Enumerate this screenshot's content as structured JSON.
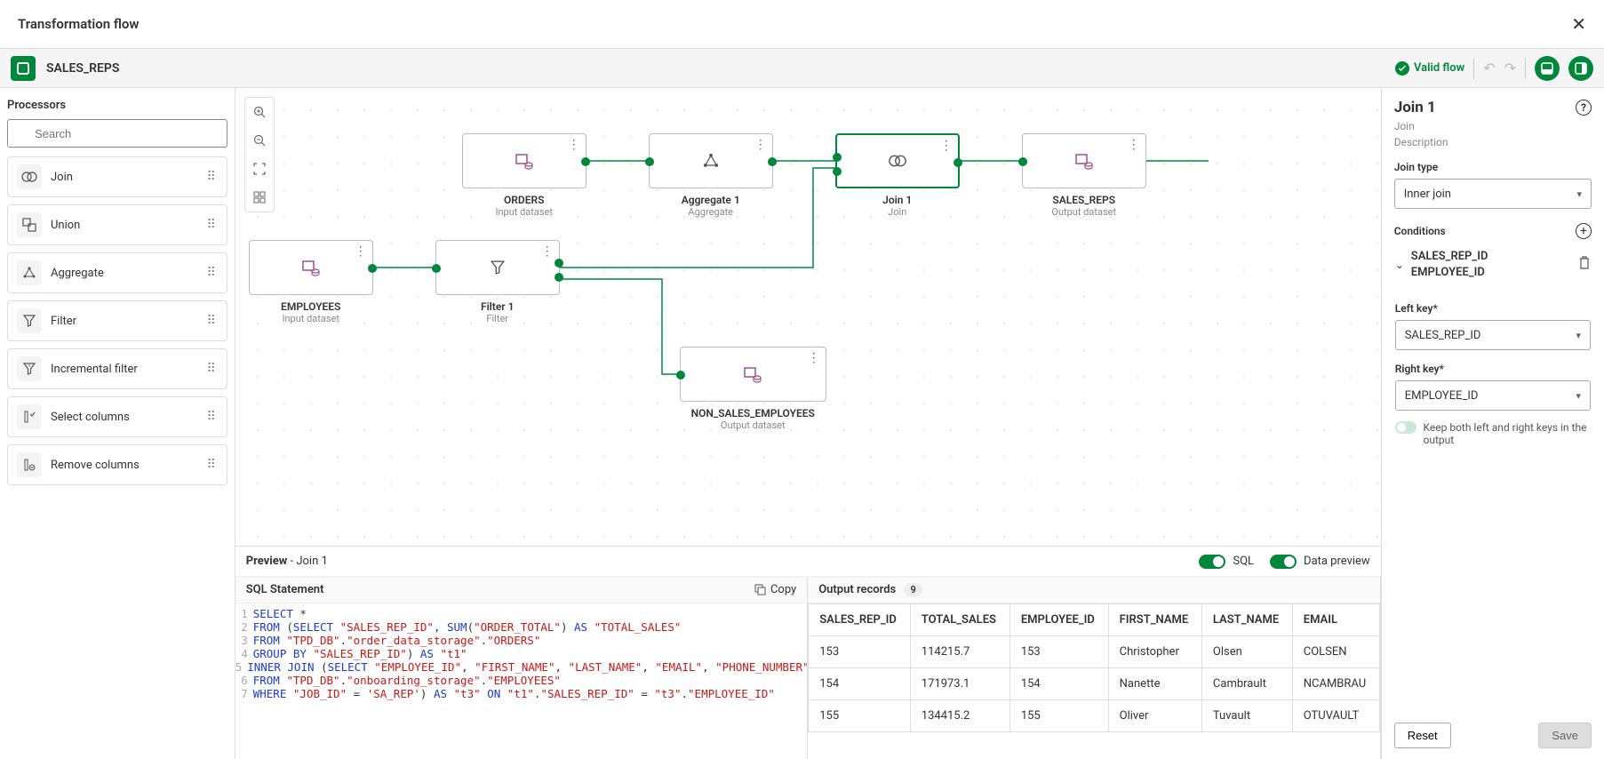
{
  "titlebar": {
    "title": "Transformation flow"
  },
  "header": {
    "flow_name": "SALES_REPS",
    "valid_flow": "Valid flow"
  },
  "sidebar": {
    "section_label": "Processors",
    "search_placeholder": "Search",
    "items": [
      {
        "label": "Join"
      },
      {
        "label": "Union"
      },
      {
        "label": "Aggregate"
      },
      {
        "label": "Filter"
      },
      {
        "label": "Incremental filter"
      },
      {
        "label": "Select columns"
      },
      {
        "label": "Remove columns"
      }
    ]
  },
  "canvas": {
    "nodes": {
      "orders": {
        "name": "ORDERS",
        "type": "Input dataset"
      },
      "employees": {
        "name": "EMPLOYEES",
        "type": "Input dataset"
      },
      "aggregate": {
        "name": "Aggregate 1",
        "type": "Aggregate"
      },
      "filter": {
        "name": "Filter 1",
        "type": "Filter"
      },
      "join": {
        "name": "Join 1",
        "type": "Join"
      },
      "salesreps": {
        "name": "SALES_REPS",
        "type": "Output dataset"
      },
      "nonsales": {
        "name": "NON_SALES_EMPLOYEES",
        "type": "Output dataset"
      }
    }
  },
  "preview": {
    "label": "Preview",
    "context": "Join 1",
    "sql_label": "SQL",
    "data_label": "Data preview",
    "sql_title": "SQL Statement",
    "copy_label": "Copy",
    "output_label": "Output records",
    "output_count": "9",
    "columns": [
      "SALES_REP_ID",
      "TOTAL_SALES",
      "EMPLOYEE_ID",
      "FIRST_NAME",
      "LAST_NAME",
      "EMAIL"
    ],
    "rows": [
      [
        "153",
        "114215.7",
        "153",
        "Christopher",
        "Olsen",
        "COLSEN"
      ],
      [
        "154",
        "171973.1",
        "154",
        "Nanette",
        "Cambrault",
        "NCAMBRAU"
      ],
      [
        "155",
        "134415.2",
        "155",
        "Oliver",
        "Tuvault",
        "OTUVAULT"
      ]
    ]
  },
  "right_panel": {
    "title": "Join 1",
    "type_label": "Join",
    "desc_label": "Description",
    "join_type_label": "Join type",
    "join_type_value": "Inner join",
    "conditions_label": "Conditions",
    "cond_key1": "SALES_REP_ID",
    "cond_key2": "EMPLOYEE_ID",
    "left_key_label": "Left key*",
    "left_key_value": "SALES_REP_ID",
    "right_key_label": "Right key*",
    "right_key_value": "EMPLOYEE_ID",
    "keep_label": "Keep both left and right keys in the output",
    "reset_label": "Reset",
    "save_label": "Save"
  }
}
